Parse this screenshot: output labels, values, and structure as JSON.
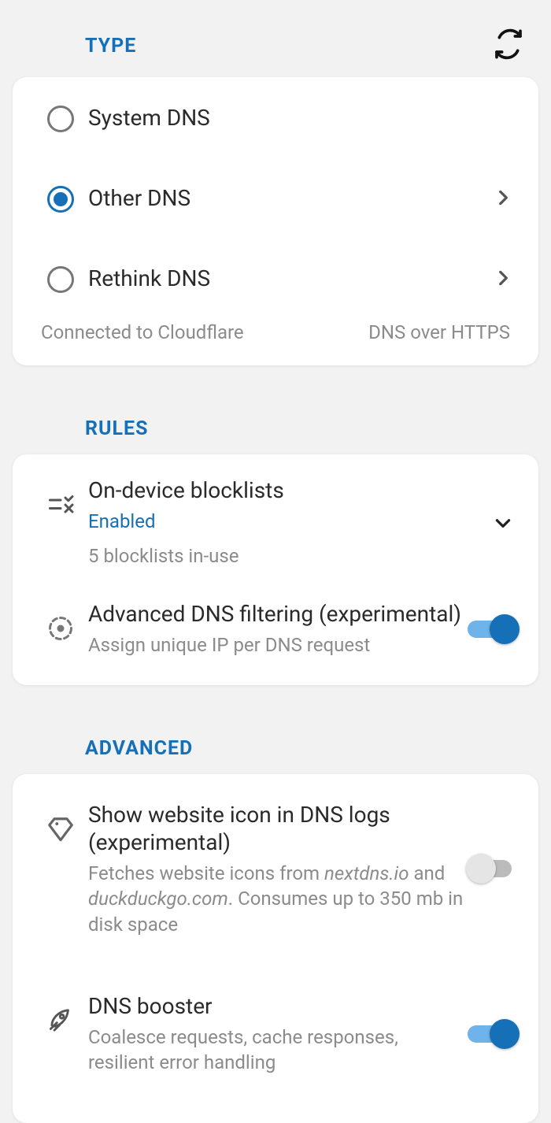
{
  "sections": {
    "type": {
      "title": "TYPE"
    },
    "rules": {
      "title": "RULES"
    },
    "advanced": {
      "title": "ADVANCED"
    }
  },
  "dns": {
    "options": [
      {
        "label": "System DNS"
      },
      {
        "label": "Other DNS"
      },
      {
        "label": "Rethink DNS"
      }
    ],
    "footer_left": "Connected to Cloudflare",
    "footer_right": "DNS over HTTPS"
  },
  "rules": {
    "blocklists": {
      "title": "On-device blocklists",
      "status": "Enabled",
      "sub": "5 blocklists in-use"
    },
    "filtering": {
      "title": "Advanced DNS filtering (experimental)",
      "sub": "Assign unique IP per DNS request"
    }
  },
  "advanced": {
    "favicon": {
      "title": "Show website icon in DNS logs (experimental)",
      "sub": "Fetches website icons from nextdns.io and duckduckgo.com. Consumes up to 350 mb in disk space"
    },
    "booster": {
      "title": "DNS booster",
      "sub": "Coalesce requests, cache responses, resilient error handling"
    }
  }
}
